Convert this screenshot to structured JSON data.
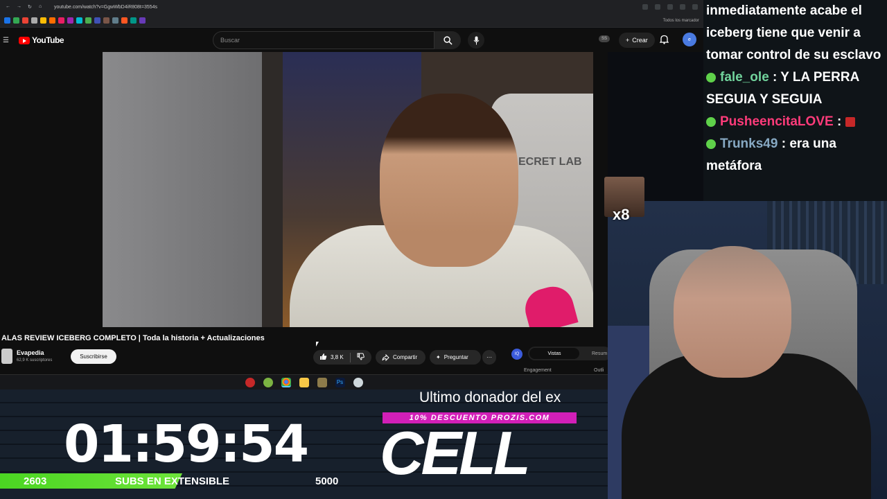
{
  "browser": {
    "url": "youtube.com/watch?v=GgwWbD4iR808t=3554s",
    "bookmarks_label": "Todos los marcador"
  },
  "header": {
    "logo_text": "YouTube",
    "search_placeholder": "Buscar",
    "ss_badge": "SS",
    "create_label": "Crear",
    "avatar_text": "e"
  },
  "video": {
    "title": "ALAS REVIEW ICEBERG COMPLETO | Toda la historia + Actualizaciones",
    "channel": "Evapedia",
    "subscribers": "62,9 K suscriptores",
    "subscribe_label": "Suscribirse",
    "likes": "3,8 K",
    "share_label": "Compartir",
    "ask_label": "Preguntar",
    "more_label": "···",
    "chair_brand": "ECRET LAB"
  },
  "side_panel": {
    "iq": "IQ",
    "tab_active": "Vistas",
    "tab_other": "Resum",
    "engagement": "Engagement",
    "outline": "Outli"
  },
  "overlay": {
    "timer": "01:59:54",
    "subs_current": "2603",
    "subs_label": "SUBS EN EXTENSIBLE",
    "subs_goal": "5000",
    "subs_fraction": 0.3,
    "ticker": "Ultimo donador del ex",
    "promo": "10% DESCUENTO PROZIS.COM",
    "donor_name": "CELL",
    "emote_multiplier": "x8"
  },
  "chat": {
    "messages": [
      {
        "user": "",
        "text": "inmediatamente acabe el iceberg tiene que venir a tomar control de su esclavo"
      },
      {
        "user": "fale_ole",
        "text": " : Y LA PERRA SEGUIA Y SEGUIA"
      },
      {
        "user": "PusheencitaLOVE",
        "text": " : "
      },
      {
        "user": "Trunks49",
        "text": " : era una metáfora"
      }
    ]
  },
  "colors": {
    "accent_red": "#ff0000",
    "progress_green": "#4bd622",
    "promo_magenta": "#d21fb8"
  }
}
